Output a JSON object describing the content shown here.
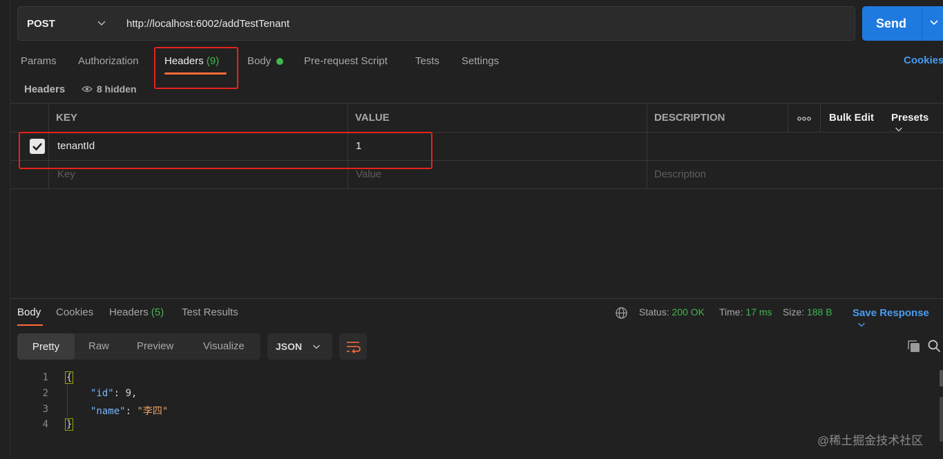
{
  "request": {
    "method": "POST",
    "url": "http://localhost:6002/addTestTenant",
    "send_label": "Send"
  },
  "tabs": {
    "params": "Params",
    "authorization": "Authorization",
    "headers": "Headers",
    "headers_count": "(9)",
    "body": "Body",
    "prerequest": "Pre-request Script",
    "tests": "Tests",
    "settings": "Settings",
    "cookies": "Cookies"
  },
  "headers_section": {
    "title": "Headers",
    "hidden": "8 hidden",
    "columns": {
      "key": "KEY",
      "value": "VALUE",
      "description": "DESCRIPTION"
    },
    "tools": {
      "more": "ooo",
      "bulk_edit": "Bulk Edit",
      "presets": "Presets"
    },
    "rows": [
      {
        "key": "tenantId",
        "value": "1",
        "description": "",
        "checked": true
      }
    ],
    "placeholders": {
      "key": "Key",
      "value": "Value",
      "description": "Description"
    }
  },
  "response": {
    "tabs": {
      "body": "Body",
      "cookies": "Cookies",
      "headers": "Headers",
      "headers_count": "(5)",
      "test_results": "Test Results"
    },
    "status_label": "Status:",
    "status_value": "200 OK",
    "time_label": "Time:",
    "time_value": "17 ms",
    "size_label": "Size:",
    "size_value": "188 B",
    "save_response": "Save Response",
    "views": {
      "pretty": "Pretty",
      "raw": "Raw",
      "preview": "Preview",
      "visualize": "Visualize"
    },
    "format": "JSON",
    "code": {
      "line_numbers": [
        "1",
        "2",
        "3",
        "4"
      ],
      "open_brace": "{",
      "close_brace": "}",
      "id_key": "\"id\"",
      "id_value": "9,",
      "name_key": "\"name\"",
      "name_value": "\"李四\""
    }
  },
  "watermark": "@稀土掘金技术社区",
  "colors": {
    "send": "#1f7ae0",
    "accent": "#ff6c37",
    "success": "#3fb950",
    "link": "#4a9cf0",
    "highlight": "#e8231b"
  }
}
